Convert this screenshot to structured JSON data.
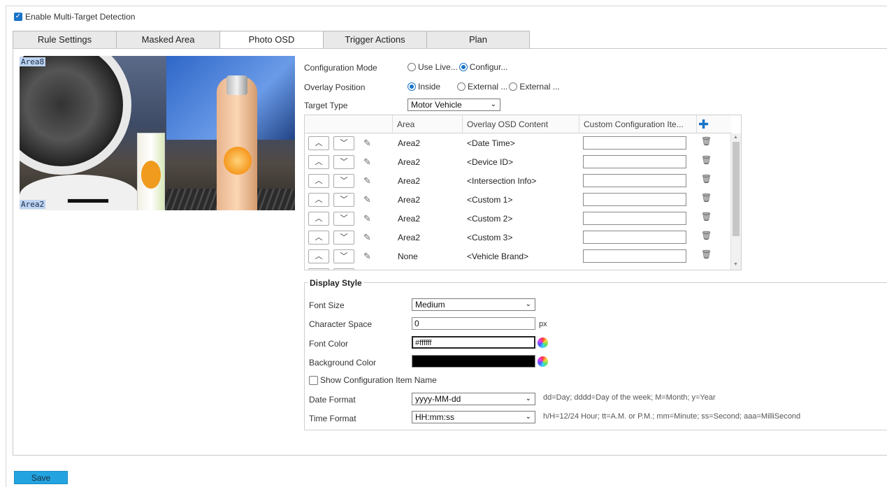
{
  "enable": {
    "label": "Enable Multi-Target Detection",
    "checked": true
  },
  "tabs": [
    {
      "label": "Rule Settings",
      "active": false
    },
    {
      "label": "Masked Area",
      "active": false
    },
    {
      "label": "Photo OSD",
      "active": true
    },
    {
      "label": "Trigger Actions",
      "active": false
    },
    {
      "label": "Plan",
      "active": false
    }
  ],
  "preview": {
    "top_area_label": "Area8",
    "bottom_area_label": "Area2"
  },
  "config": {
    "mode_label": "Configuration Mode",
    "mode_options": [
      {
        "label": "Use Live...",
        "selected": false
      },
      {
        "label": "Configur...",
        "selected": true
      }
    ],
    "overlay_label": "Overlay Position",
    "overlay_options": [
      {
        "label": "Inside",
        "selected": true
      },
      {
        "label": "External ...",
        "selected": false
      },
      {
        "label": "External ...",
        "selected": false
      }
    ],
    "target_type_label": "Target Type",
    "target_type_value": "Motor Vehicle"
  },
  "grid": {
    "headers": {
      "area": "Area",
      "content": "Overlay OSD Content",
      "custom": "Custom Configuration Ite..."
    },
    "rows": [
      {
        "area": "Area2",
        "content": "<Date Time>",
        "custom": ""
      },
      {
        "area": "Area2",
        "content": "<Device ID>",
        "custom": ""
      },
      {
        "area": "Area2",
        "content": "<Intersection Info>",
        "custom": ""
      },
      {
        "area": "Area2",
        "content": "<Custom 1>",
        "custom": ""
      },
      {
        "area": "Area2",
        "content": "<Custom 2>",
        "custom": ""
      },
      {
        "area": "Area2",
        "content": "<Custom 3>",
        "custom": ""
      },
      {
        "area": "None",
        "content": "<Vehicle Brand>",
        "custom": ""
      }
    ]
  },
  "display_style": {
    "legend": "Display Style",
    "font_size_label": "Font Size",
    "font_size_value": "Medium",
    "char_space_label": "Character Space",
    "char_space_value": "0",
    "char_space_unit": "px",
    "font_color_label": "Font Color",
    "font_color_value": "#ffffff",
    "bg_color_label": "Background Color",
    "bg_color_value": "#000000",
    "show_name_label": "Show Configuration Item Name",
    "date_format_label": "Date Format",
    "date_format_value": "yyyy-MM-dd",
    "date_format_hint": "dd=Day; dddd=Day of the week; M=Month; y=Year",
    "time_format_label": "Time Format",
    "time_format_value": "HH:mm:ss",
    "time_format_hint": "h/H=12/24 Hour; tt=A.M. or P.M.; mm=Minute; ss=Second; aaa=MilliSecond"
  },
  "save_label": "Save",
  "colors": {
    "accent": "#1a73c9",
    "save_button": "#23a4e0"
  }
}
